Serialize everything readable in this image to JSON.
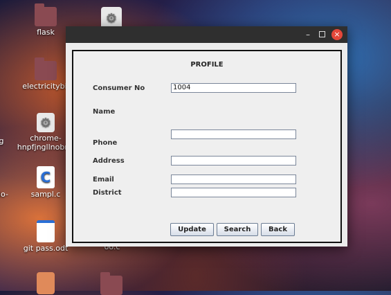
{
  "desktop": {
    "icons": [
      {
        "label": "flask"
      },
      {
        "label": "electricitybil"
      },
      {
        "label": "chrome-\nhnpfjngllnobng"
      },
      {
        "label": "sampl.c"
      },
      {
        "label": "git pass.odt"
      }
    ],
    "partial_labels": [
      "g",
      "do-",
      "oo.c"
    ]
  },
  "window": {
    "title": "",
    "controls": {
      "minimize": "–",
      "close": "×"
    }
  },
  "form": {
    "heading": "PROFILE",
    "labels": {
      "consumer_no": "Consumer No",
      "name": "Name",
      "phone": "Phone",
      "address": "Address",
      "email": "Email",
      "district": "District"
    },
    "values": {
      "consumer_no": "1004",
      "phone": "",
      "address": "",
      "email": "",
      "district": ""
    },
    "buttons": {
      "update": "Update",
      "search": "Search",
      "back": "Back"
    }
  },
  "colors": {
    "titlebar": "#2f2f2f",
    "close_button": "#e5473a",
    "window_bg": "#ececec"
  }
}
